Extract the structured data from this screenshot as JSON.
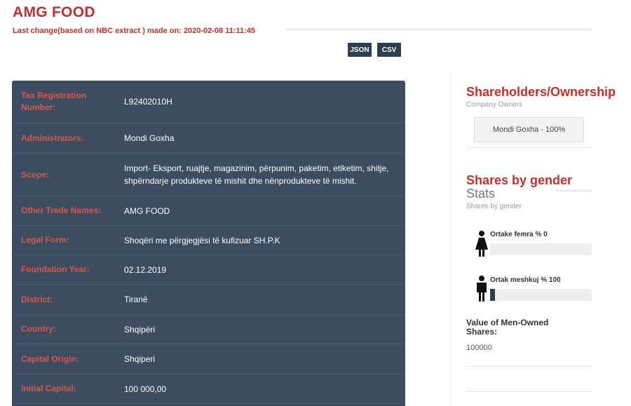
{
  "header": {
    "title": "AMG FOOD",
    "last_change": "Last change(based on NBC extract ) made on: 2020-02-08 11:11:45"
  },
  "buttons": {
    "json": "JSON",
    "csv": "CSV"
  },
  "details": [
    {
      "label": "Tax Registration Number:",
      "value": "L92402010H"
    },
    {
      "label": "Administrators:",
      "value": "Mondi Goxha"
    },
    {
      "label": "Scope:",
      "value": "Import- Eksport, ruajtje, magazinim, përpunim, paketim, etiketim, shitje, shpërndarje produkteve të mishit dhe nënprodukteve të mishit."
    },
    {
      "label": "Other Trade Names:",
      "value": "AMG FOOD"
    },
    {
      "label": "Legal Form:",
      "value": "Shoqëri me përgjegjësi të kufizuar SH.P.K"
    },
    {
      "label": "Foundation Year:",
      "value": "02.12.2019"
    },
    {
      "label": "District:",
      "value": "Tiranë"
    },
    {
      "label": "Country:",
      "value": "Shqipëri"
    },
    {
      "label": "Capital Origin:",
      "value": "Shqiperi"
    },
    {
      "label": "Initial Capital:",
      "value": "100 000,00"
    }
  ],
  "shareholders": {
    "title": "Shareholders/Ownership",
    "subtitle": "Company Owners",
    "owners": [
      "Mondi Goxha - 100%"
    ]
  },
  "gender": {
    "title": "Shares by gender",
    "stats_label": "Stats",
    "stats_sub": "Shares by gender",
    "female": {
      "label": "Ortake femra % 0",
      "percent": 0,
      "icon": "female-figure-icon"
    },
    "male": {
      "label": "Ortak meshkuj % 100",
      "percent": 100,
      "icon": "male-figure-icon"
    },
    "bar_color": "#2c3e50"
  },
  "men_owned": {
    "title": "Value of Men-Owned Shares:",
    "value": "100000"
  },
  "colors": {
    "accent": "#c0302c",
    "panel": "#3d4d61",
    "label": "#d6584a",
    "button": "#2c3e50"
  }
}
